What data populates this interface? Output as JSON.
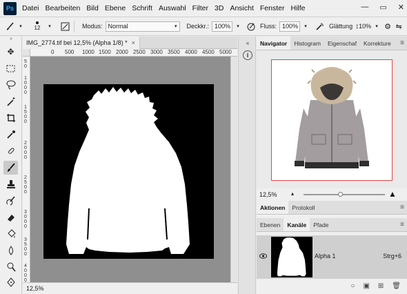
{
  "menubar": {
    "logo": "Ps",
    "items": [
      "Datei",
      "Bearbeiten",
      "Bild",
      "Ebene",
      "Schrift",
      "Auswahl",
      "Filter",
      "3D",
      "Ansicht",
      "Fenster",
      "Hilfe"
    ],
    "window_controls": [
      "—",
      "▭",
      "✕"
    ]
  },
  "options": {
    "brush_size": "12",
    "modus_label": "Modus:",
    "modus_value": "Normal",
    "deckkr_label": "Deckkr.:",
    "deckkr_value": "100%",
    "fluss_label": "Fluss:",
    "fluss_value": "100%",
    "glaettung_label": "Glättung",
    "glaettung_value": "10%"
  },
  "document": {
    "tab_title": "IMG_2774.tif bei 12,5% (Alpha 1/8) *",
    "tab_close": "×",
    "ruler_h": [
      "0",
      "500",
      "1000",
      "1500",
      "2000",
      "2500",
      "3000",
      "3500",
      "4000",
      "4500",
      "5000"
    ],
    "ruler_v": [
      "5",
      "0",
      "1",
      "0",
      "0",
      "0",
      "1",
      "5",
      "0",
      "0",
      "2",
      "0",
      "0",
      "0",
      "2",
      "5",
      "0",
      "0",
      "3",
      "0",
      "0",
      "0",
      "3",
      "5",
      "0",
      "0",
      "4",
      "0",
      "0",
      "0"
    ],
    "status_zoom": "12,5%"
  },
  "side_strip": {
    "collapse": "«",
    "info_icon": "i"
  },
  "navigator": {
    "tabs": [
      "Navigator",
      "Histogram",
      "Eigenschaf",
      "Korrekture"
    ],
    "zoom_value": "12,5%",
    "zoom_fraction": 0.45
  },
  "actions_panel": {
    "tabs": [
      "Aktionen",
      "Protokoll"
    ]
  },
  "layers_panel": {
    "tabs": [
      "Ebenen",
      "Kanäle",
      "Pfade"
    ],
    "channel_name": "Alpha 1",
    "channel_shortcut": "Strg+6",
    "footer_icons": [
      "○",
      "▣",
      "⊞",
      "🗑"
    ]
  },
  "colors": {
    "navigator_frame": "#e0454b",
    "jacket_body": "#a39d9f",
    "fur": "#c9b79d",
    "cuffs": "#2e2e2e"
  }
}
